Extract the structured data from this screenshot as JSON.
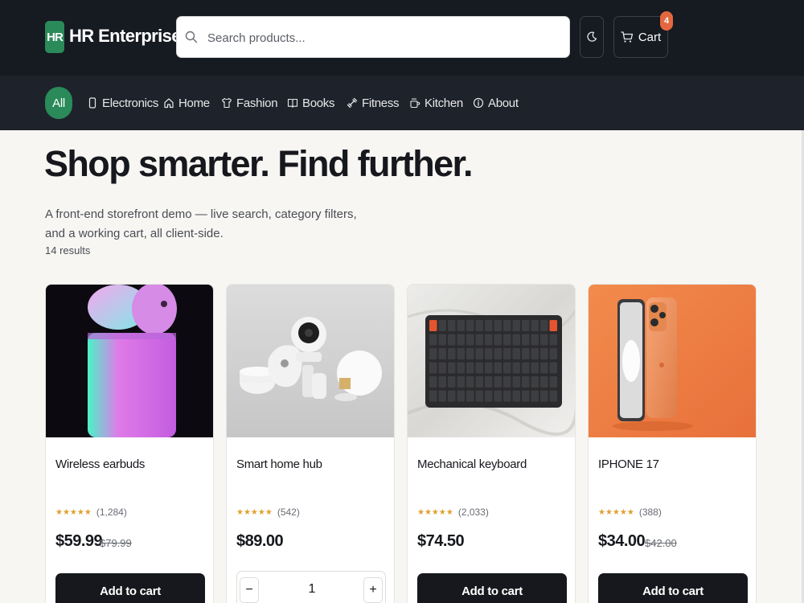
{
  "header": {
    "logo_badge": "HR",
    "logo_text": "HR Enterprises",
    "search_placeholder": "Search products...",
    "cart_label": "Cart",
    "cart_count": "4"
  },
  "categories": [
    {
      "label": "All",
      "icon": "none"
    },
    {
      "label": "Electronics",
      "icon": "phone-icon"
    },
    {
      "label": "Home",
      "icon": "house-icon"
    },
    {
      "label": "Fashion",
      "icon": "shirt-icon"
    },
    {
      "label": "Books",
      "icon": "book-icon"
    },
    {
      "label": "Fitness",
      "icon": "dumbbell-icon"
    },
    {
      "label": "Kitchen",
      "icon": "mug-icon"
    },
    {
      "label": "About",
      "icon": "info-icon"
    }
  ],
  "hero": {
    "title": "Shop smarter. Find further.",
    "subtitle": "A front-end storefront demo — live search, category filters, and a working cart, all client-side.",
    "result_count": "14 results"
  },
  "products": [
    {
      "name": "Wireless earbuds",
      "stars": "★★★★★",
      "reviews": "(1,284)",
      "price": "$59.99",
      "old_price": "$79.99",
      "action": "Add to cart"
    },
    {
      "name": "Smart home hub",
      "stars": "★★★★★",
      "reviews": "(542)",
      "price": "$89.00",
      "old_price": "",
      "quantity": "1",
      "minus": "−",
      "plus": "+"
    },
    {
      "name": "Mechanical keyboard",
      "stars": "★★★★★",
      "reviews": "(2,033)",
      "price": "$74.50",
      "old_price": "",
      "action": "Add to cart"
    },
    {
      "name": "IPHONE 17",
      "stars": "★★★★★",
      "reviews": "(388)",
      "price": "$34.00",
      "old_price": "$42.00",
      "action": "Add to cart"
    }
  ],
  "colors": {
    "header_bg": "#161a21",
    "nav_bg": "#1e222a",
    "accent_green": "#2a8a5a",
    "badge_orange": "#e4683f",
    "page_bg": "#f7f6f3"
  }
}
